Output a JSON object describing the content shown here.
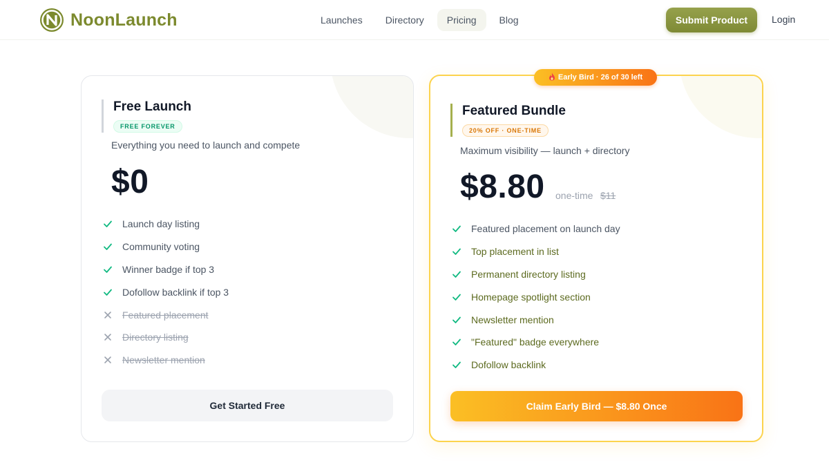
{
  "brand": {
    "name": "NoonLaunch",
    "color": "#7c8a2e"
  },
  "nav": {
    "items": [
      {
        "label": "Launches"
      },
      {
        "label": "Directory"
      },
      {
        "label": "Pricing"
      },
      {
        "label": "Blog"
      }
    ],
    "active": "Pricing",
    "submit_label": "Submit Product",
    "login_label": "Login"
  },
  "free_plan": {
    "title": "Free Launch",
    "tag": "FREE FOREVER",
    "description": "Everything you need to launch and compete",
    "price": "$0",
    "features": [
      {
        "label": "Launch day listing",
        "included": true
      },
      {
        "label": "Community voting",
        "included": true
      },
      {
        "label": "Winner badge if top 3",
        "included": true
      },
      {
        "label": "Dofollow backlink if top 3",
        "included": true
      },
      {
        "label": "Featured placement",
        "included": false
      },
      {
        "label": "Directory listing",
        "included": false
      },
      {
        "label": "Newsletter mention",
        "included": false
      }
    ],
    "cta": "Get Started Free"
  },
  "featured_plan": {
    "badge": "Early Bird · 26 of 30 left",
    "title": "Featured Bundle",
    "tag": "20% OFF · ONE-TIME",
    "description": "Maximum visibility — launch + directory",
    "price": "$8.80",
    "price_note": "one-time",
    "price_old": "$11",
    "features": [
      {
        "label": "Featured placement on launch day",
        "included": true
      },
      {
        "label": "Top placement in list",
        "included": true
      },
      {
        "label": "Permanent directory listing",
        "included": true
      },
      {
        "label": "Homepage spotlight section",
        "included": true
      },
      {
        "label": "Newsletter mention",
        "included": true
      },
      {
        "label": "\"Featured\" badge everywhere",
        "included": true
      },
      {
        "label": "Dofollow backlink",
        "included": true
      }
    ],
    "cta": "Claim Early Bird — $8.80 Once"
  },
  "colors": {
    "check": "#10b981",
    "cross": "#9ca3af",
    "accent_orange": "#f97316",
    "accent_yellow": "#fbbf24"
  }
}
